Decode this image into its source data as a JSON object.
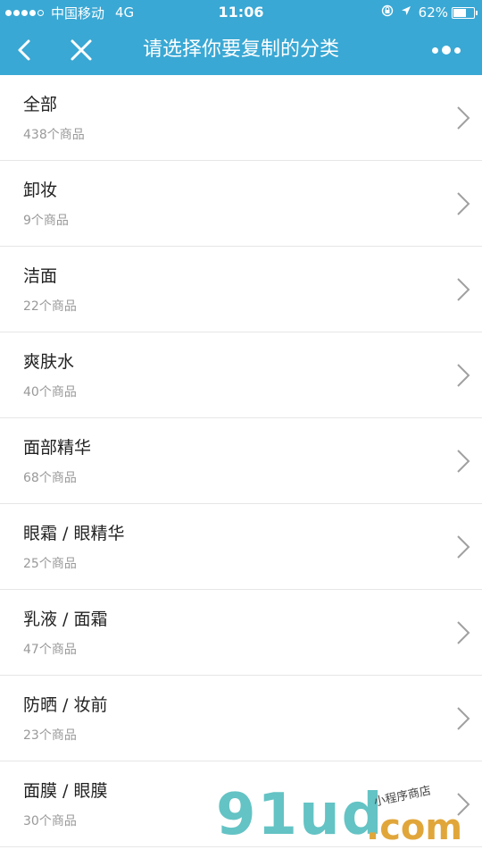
{
  "status_bar": {
    "carrier": "中国移动",
    "network": "4G",
    "time": "11:06",
    "battery": "62%",
    "battery_level": 62,
    "signal_bars_filled": 4,
    "signal_bars_total": 5
  },
  "nav": {
    "title": "请选择你要复制的分类"
  },
  "categories": [
    {
      "name": "全部",
      "count": "438个商品"
    },
    {
      "name": "卸妆",
      "count": "9个商品"
    },
    {
      "name": "洁面",
      "count": "22个商品"
    },
    {
      "name": "爽肤水",
      "count": "40个商品"
    },
    {
      "name": "面部精华",
      "count": "68个商品"
    },
    {
      "name": "眼霜 / 眼精华",
      "count": "25个商品"
    },
    {
      "name": "乳液 / 面霜",
      "count": "47个商品"
    },
    {
      "name": "防晒 / 妆前",
      "count": "23个商品"
    },
    {
      "name": "面膜 / 眼膜",
      "count": "30个商品"
    }
  ],
  "watermark": {
    "logo": "91ud",
    "domain": ".com",
    "slogan": "小程序商店"
  },
  "colors": {
    "header": "#3aa8d4",
    "text": "#222222",
    "subtext": "#999999"
  }
}
